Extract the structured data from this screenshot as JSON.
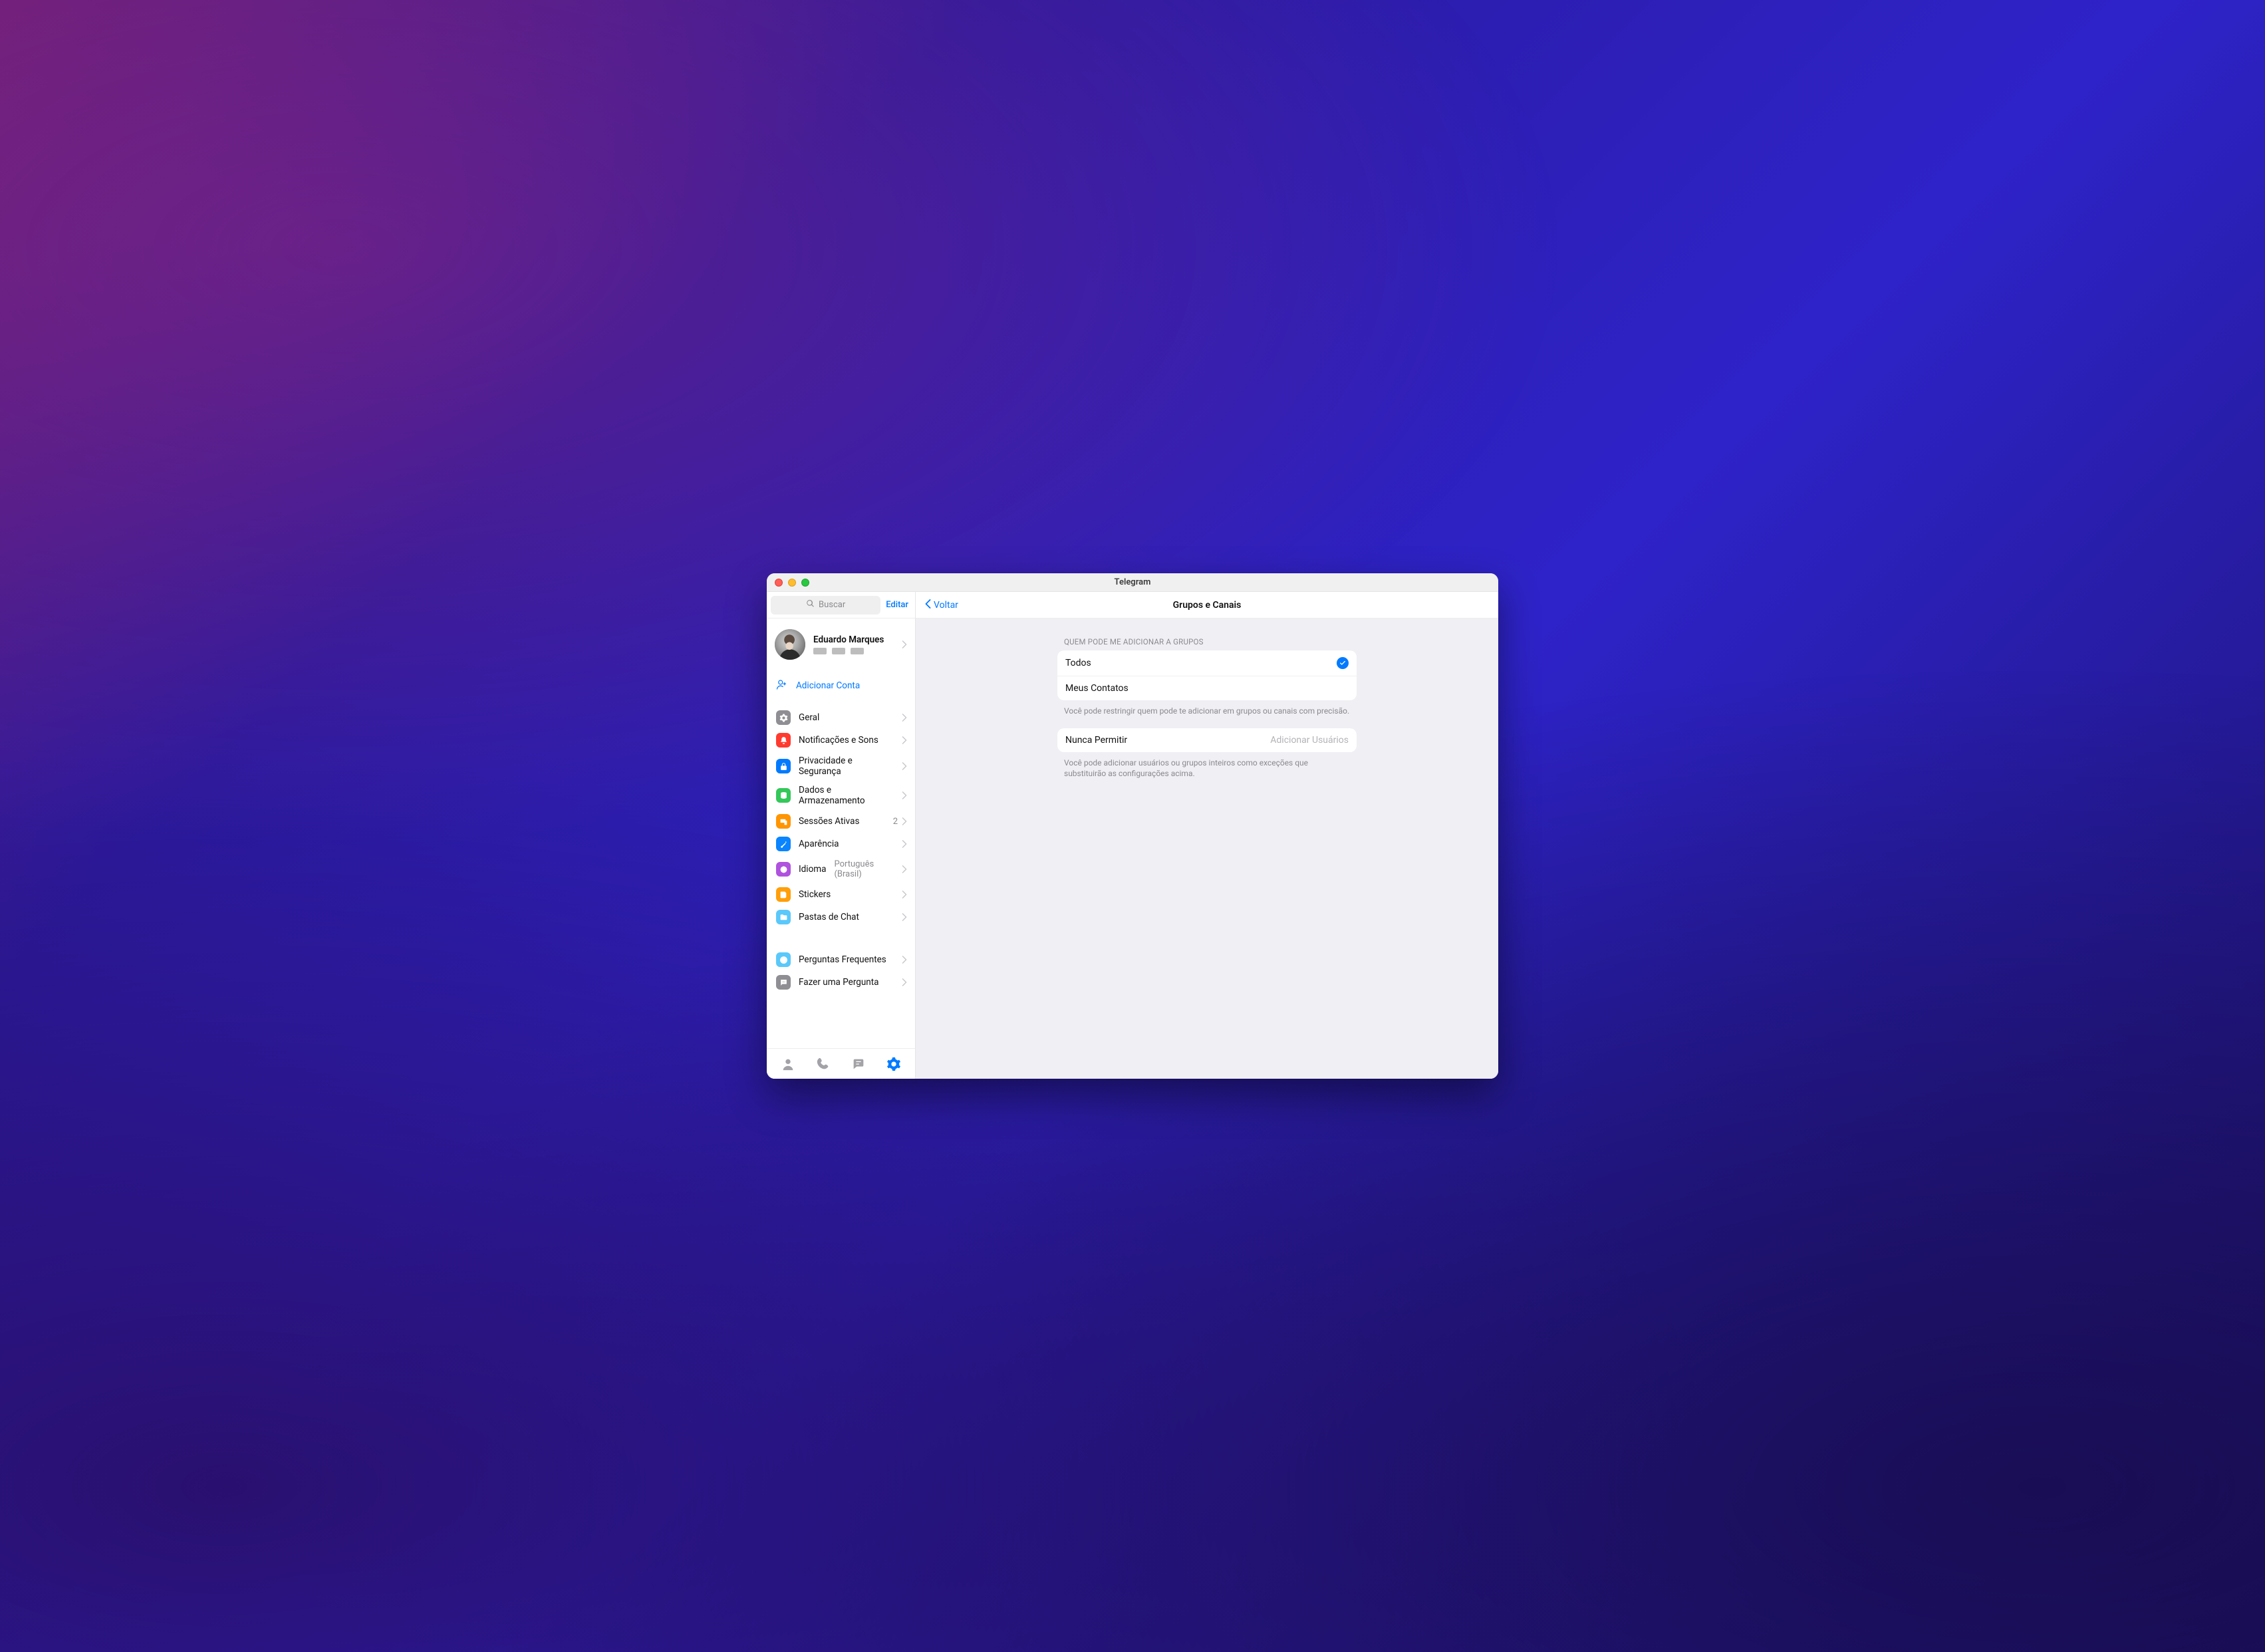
{
  "window": {
    "title": "Telegram"
  },
  "sidebar": {
    "search_placeholder": "Buscar",
    "edit": "Editar",
    "profile": {
      "name": "Eduardo Marques"
    },
    "add_account": "Adicionar Conta",
    "items": [
      {
        "label": "Geral"
      },
      {
        "label": "Notificações e Sons"
      },
      {
        "label": "Privacidade e Segurança"
      },
      {
        "label": "Dados e Armazenamento"
      },
      {
        "label": "Sessões Ativas",
        "value": "2"
      },
      {
        "label": "Aparência"
      },
      {
        "label": "Idioma",
        "value": "Português (Brasil)"
      },
      {
        "label": "Stickers"
      },
      {
        "label": "Pastas de Chat"
      }
    ],
    "items2": [
      {
        "label": "Perguntas Frequentes"
      },
      {
        "label": "Fazer uma Pergunta"
      }
    ]
  },
  "main": {
    "back": "Voltar",
    "title": "Grupos e Canais",
    "section1": {
      "header": "QUEM PODE ME ADICIONAR A GRUPOS",
      "options": [
        "Todos",
        "Meus Contatos"
      ],
      "selected": 0,
      "footer": "Você pode restringir quem pode te adicionar em grupos ou canais com precisão."
    },
    "section2": {
      "row_label": "Nunca Permitir",
      "row_action": "Adicionar Usuários",
      "footer": "Você pode adicionar usuários ou grupos inteiros como exceções que substituirão as configurações acima."
    }
  }
}
